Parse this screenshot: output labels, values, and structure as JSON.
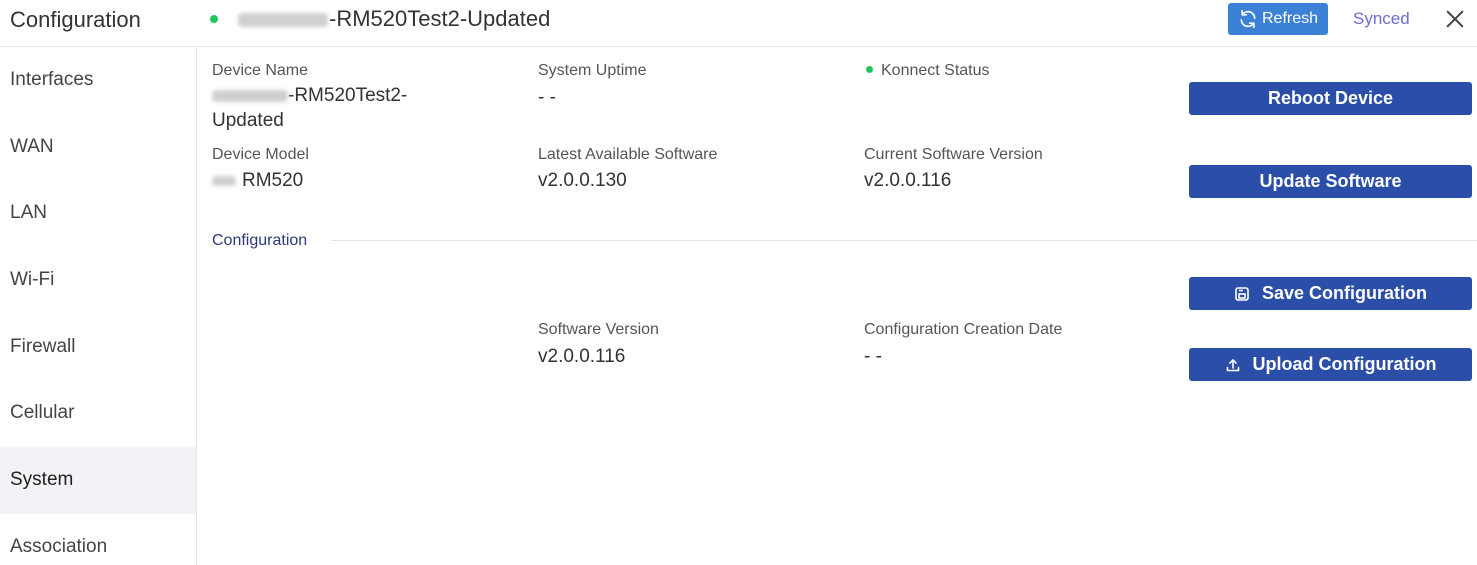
{
  "header": {
    "title": "Configuration",
    "device_title": "-RM520Test2-Updated",
    "refresh_label": "Refresh",
    "sync_status": "Synced"
  },
  "sidebar": {
    "items": [
      {
        "label": "Interfaces"
      },
      {
        "label": "WAN"
      },
      {
        "label": "LAN"
      },
      {
        "label": "Wi-Fi"
      },
      {
        "label": "Firewall"
      },
      {
        "label": "Cellular"
      },
      {
        "label": "System",
        "active": true
      },
      {
        "label": "Association"
      }
    ]
  },
  "device": {
    "name_label": "Device Name",
    "name_value_line1": "-RM520Test2-",
    "name_value_line2": "Updated",
    "uptime_label": "System Uptime",
    "uptime_value": "- -",
    "konnect_label": "Konnect Status",
    "model_label": "Device Model",
    "model_value": "RM520",
    "latest_sw_label": "Latest Available Software",
    "latest_sw_value": "v2.0.0.130",
    "current_sw_label": "Current Software Version",
    "current_sw_value": "v2.0.0.116"
  },
  "actions": {
    "reboot_label": "Reboot Device",
    "update_label": "Update Software",
    "save_config_label": "Save Configuration",
    "upload_config_label": "Upload Configuration"
  },
  "configuration": {
    "section_title": "Configuration",
    "sw_version_label": "Software Version",
    "sw_version_value": "v2.0.0.116",
    "creation_date_label": "Configuration Creation Date",
    "creation_date_value": "- -"
  },
  "colors": {
    "primary_button": "#2b4ea8",
    "refresh_button": "#3b82d6",
    "status_online": "#22c55e",
    "synced_text": "#6b6bd6"
  }
}
